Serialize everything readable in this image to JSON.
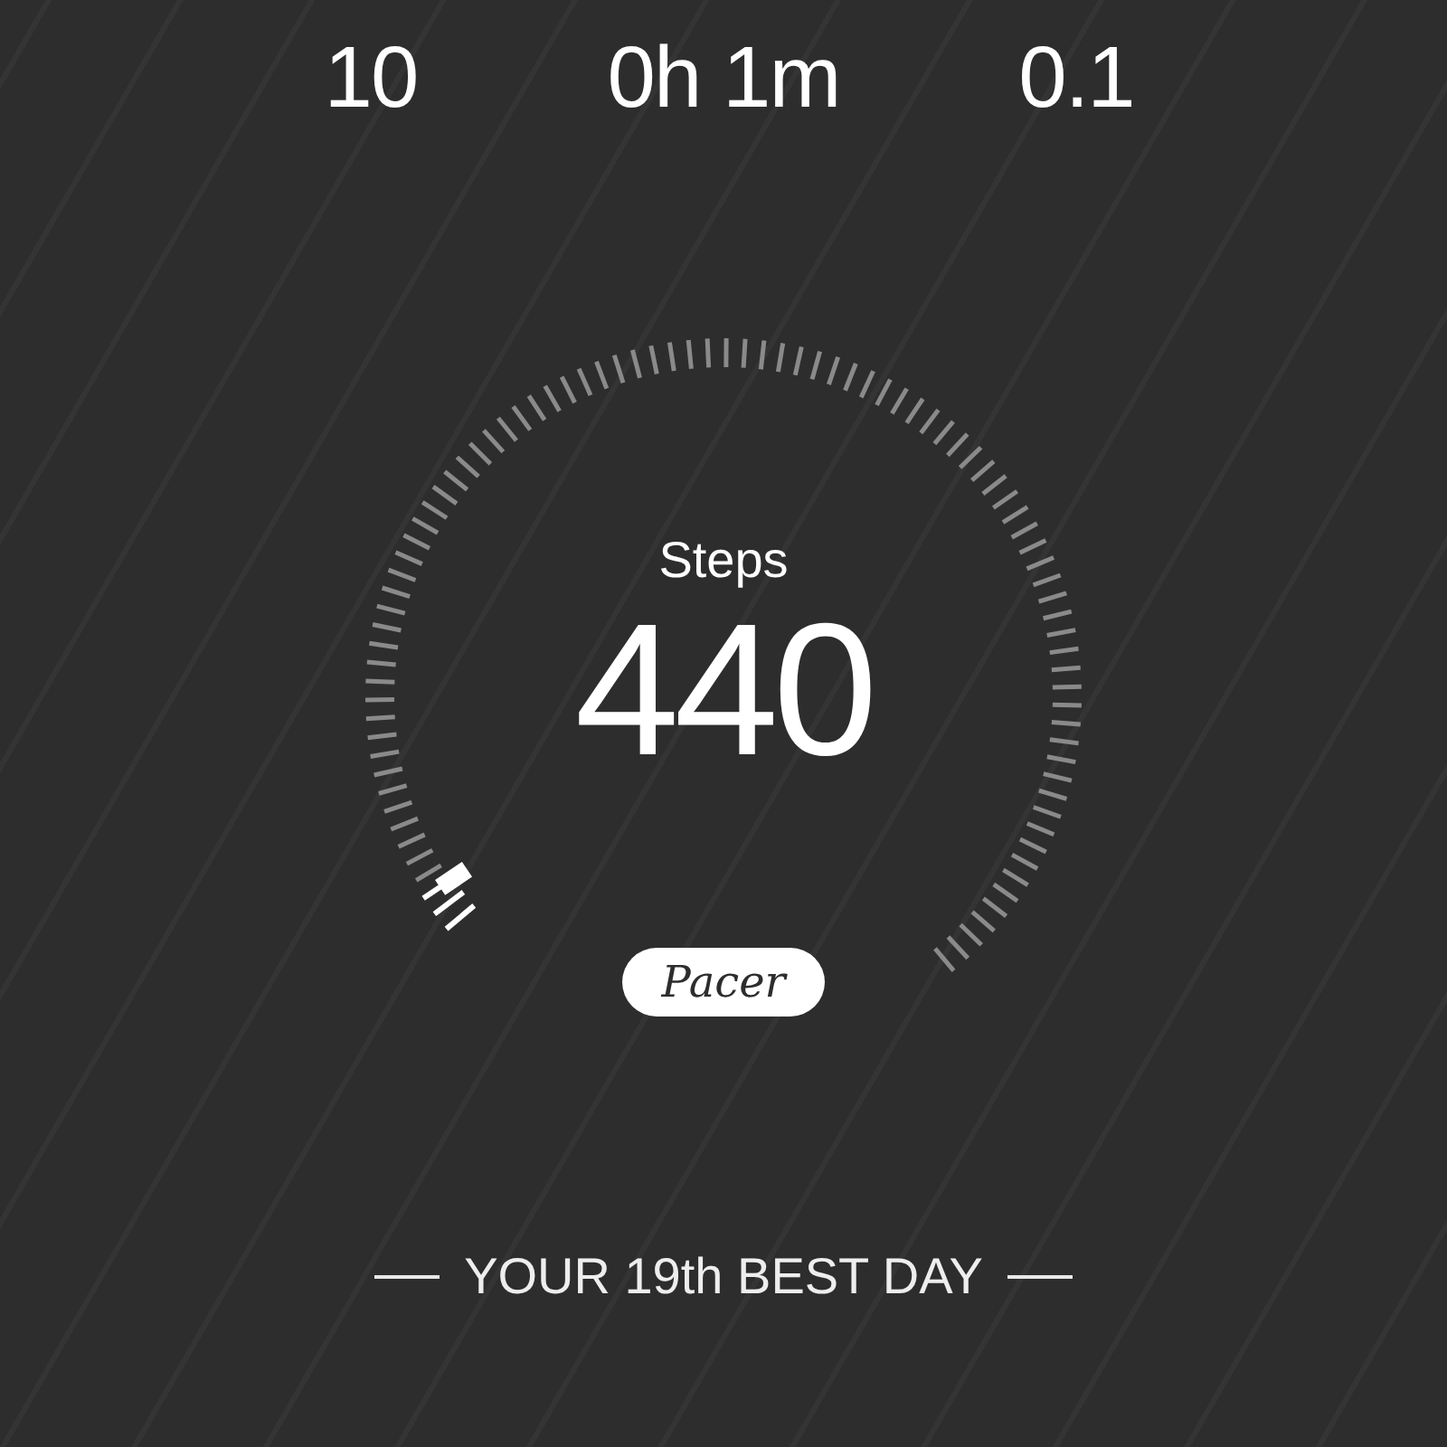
{
  "stats": [
    {
      "value": "10"
    },
    {
      "value": "0h 1m"
    },
    {
      "value": "0.1"
    }
  ],
  "gauge": {
    "label": "Steps",
    "value": "440",
    "badge": "Pacer"
  },
  "rank": "YOUR 19th BEST DAY"
}
